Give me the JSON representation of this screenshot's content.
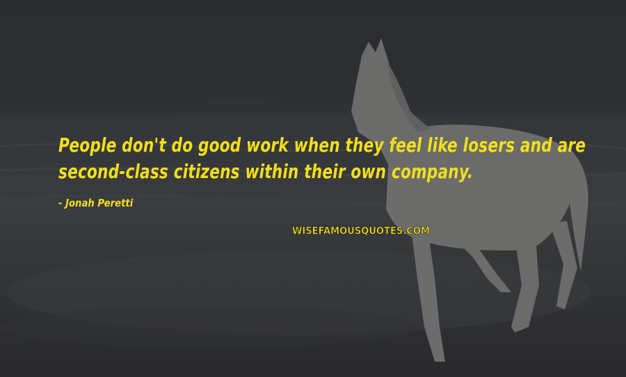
{
  "quote": {
    "lines": [
      "People don't do good work when they feel like losers and are",
      "second-class citizens within their own company."
    ],
    "author": "- Jonah Peretti"
  },
  "watermark": {
    "text": "WISEFAMOUSQUOTES.COM"
  },
  "colors": {
    "text": "#f2df1c",
    "background": "#3a3d3f"
  },
  "background_subject": "white horse running on a beach"
}
